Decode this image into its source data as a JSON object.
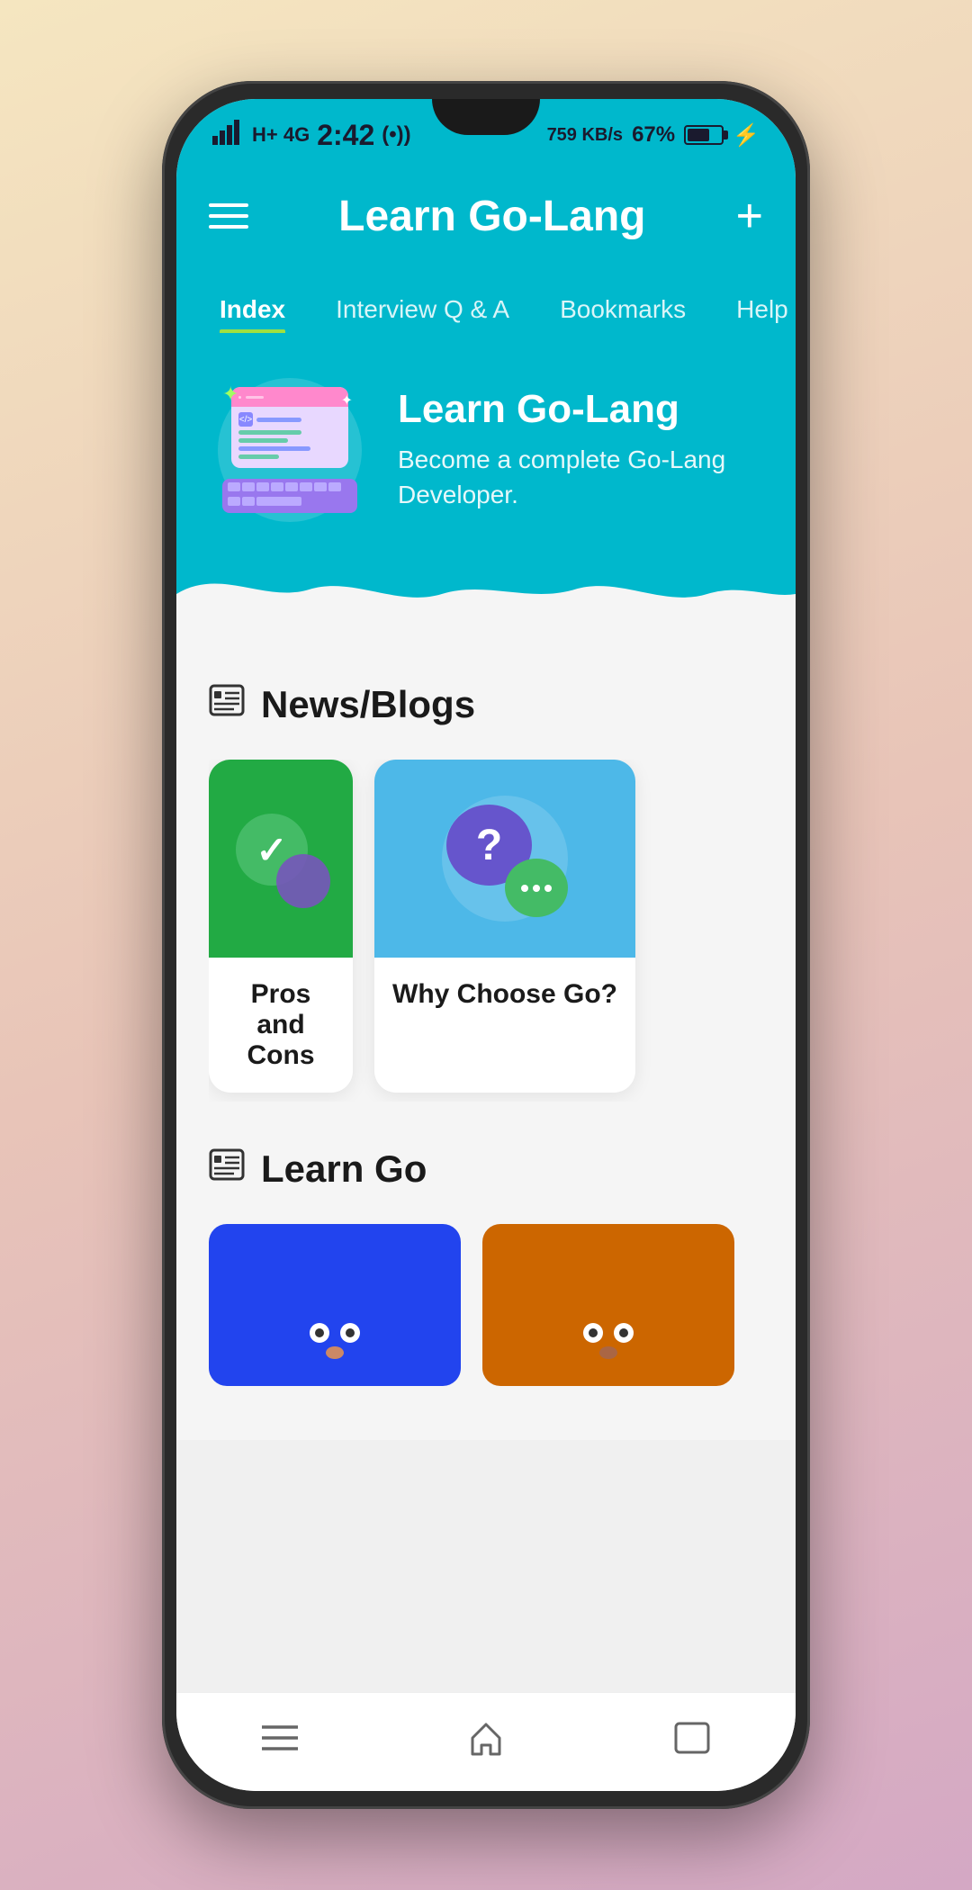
{
  "status": {
    "time": "2:42",
    "signal": "H+ 4G",
    "wifi": "(•))",
    "data_speed": "759 KB/s",
    "battery_percent": "67%",
    "charging": true
  },
  "header": {
    "title": "Learn Go-Lang",
    "plus_label": "+"
  },
  "nav": {
    "tabs": [
      {
        "label": "Index",
        "active": true
      },
      {
        "label": "Interview Q & A",
        "active": false
      },
      {
        "label": "Bookmarks",
        "active": false
      },
      {
        "label": "Help",
        "active": false
      }
    ]
  },
  "hero": {
    "app_name": "Learn Go-Lang",
    "subtitle": "Become a complete Go-Lang Developer."
  },
  "news_blogs": {
    "section_title": "News/Blogs",
    "cards": [
      {
        "id": "card1",
        "title": "Pros and Cons",
        "partial": true
      },
      {
        "id": "card2",
        "title": "Why Choose Go?",
        "partial": false
      }
    ]
  },
  "learn_go": {
    "section_title": "Learn Go",
    "cards": [
      {
        "id": "lc1",
        "color": "blue"
      },
      {
        "id": "lc2",
        "color": "orange"
      }
    ]
  },
  "bottom_nav": {
    "items": [
      {
        "icon": "☰",
        "label": "menu"
      },
      {
        "icon": "⌂",
        "label": "home"
      },
      {
        "icon": "⬜",
        "label": "back"
      }
    ]
  }
}
